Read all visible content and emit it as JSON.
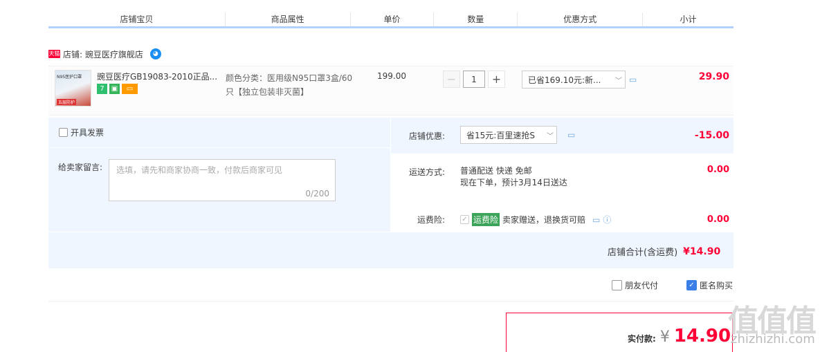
{
  "header": {
    "columns": [
      "店铺宝贝",
      "商品属性",
      "单价",
      "数量",
      "优惠方式",
      "小计"
    ]
  },
  "shop": {
    "tmall_badge": "天猫",
    "label": "店铺: 豌豆医疗旗舰店",
    "ww_icon": "wangwang-chat-icon"
  },
  "item": {
    "thumb_top": "N95医护口罩",
    "thumb_bottom": "五层防护",
    "title": "豌豆医疗GB19083-2010正品...",
    "badges": [
      "7",
      "",
      ""
    ],
    "attr": "颜色分类：医用级N95口罩3盒/60只【独立包装非灭菌】",
    "price": "199.00",
    "qty": "1",
    "minus": "−",
    "plus": "+",
    "discount": "已省169.10元:新...",
    "subtotal": "29.90"
  },
  "options": {
    "invoice": "开具发票",
    "msg_label": "给卖家留言:",
    "msg_placeholder": "选填，请先和商家协商一致，付款后商家可见",
    "msg_count": "0/200",
    "shop_discount_label": "店铺优惠:",
    "shop_discount_value": "省15元:百里速抢S",
    "shop_discount_amount": "-15.00",
    "delivery_label": "运送方式:",
    "delivery_line1": "普通配送 快递 免邮",
    "delivery_line2": "现在下单，预计3月14日送达",
    "delivery_amount": "0.00",
    "insurance_label": "运费险:",
    "insurance_badge": "运费险",
    "insurance_text": "卖家赠送，退换货可赔",
    "insurance_amount": "0.00"
  },
  "total": {
    "label": "店铺合计(含运费)",
    "value": "¥14.90"
  },
  "extras": {
    "friend_pay": "朋友代付",
    "anonymous": "匿名购买"
  },
  "pay": {
    "label": "实付款:",
    "currency": "¥",
    "amount": "14.90"
  },
  "watermark": {
    "big": "值值值",
    "small": "zhizhizhi.com"
  },
  "colors": {
    "accent": "#ff0036",
    "blue": "#3a7ee8",
    "panel": "#f0f6ff"
  }
}
